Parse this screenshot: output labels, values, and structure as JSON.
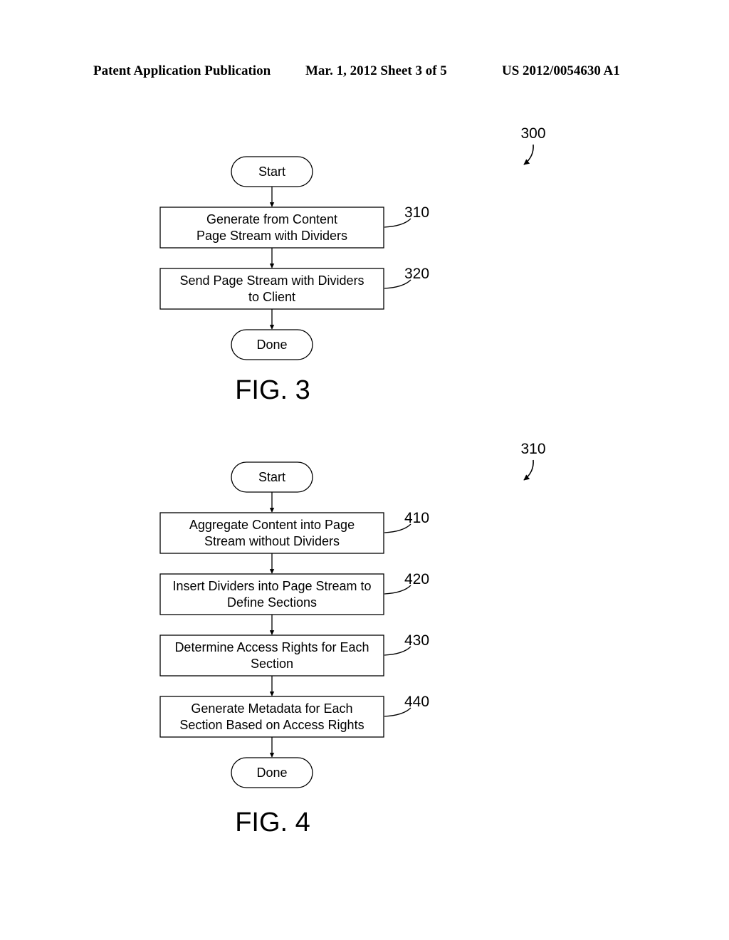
{
  "header": {
    "left": "Patent Application Publication",
    "center": "Mar. 1, 2012   Sheet 3 of 5",
    "right": "US 2012/0054630 A1"
  },
  "figures": [
    {
      "label": "FIG. 3",
      "ref": "300",
      "start": "Start",
      "done": "Done",
      "steps": [
        {
          "ref": "310",
          "lines": [
            "Generate from Content",
            "Page Stream with Dividers"
          ]
        },
        {
          "ref": "320",
          "lines": [
            "Send Page Stream with Dividers",
            "to Client"
          ]
        }
      ]
    },
    {
      "label": "FIG. 4",
      "ref": "310",
      "start": "Start",
      "done": "Done",
      "steps": [
        {
          "ref": "410",
          "lines": [
            "Aggregate Content into Page",
            "Stream without Dividers"
          ]
        },
        {
          "ref": "420",
          "lines": [
            "Insert Dividers into Page Stream to",
            "Define Sections"
          ]
        },
        {
          "ref": "430",
          "lines": [
            "Determine Access Rights for Each",
            "Section"
          ]
        },
        {
          "ref": "440",
          "lines": [
            "Generate Metadata for Each",
            "Section Based on Access Rights"
          ]
        }
      ]
    }
  ]
}
